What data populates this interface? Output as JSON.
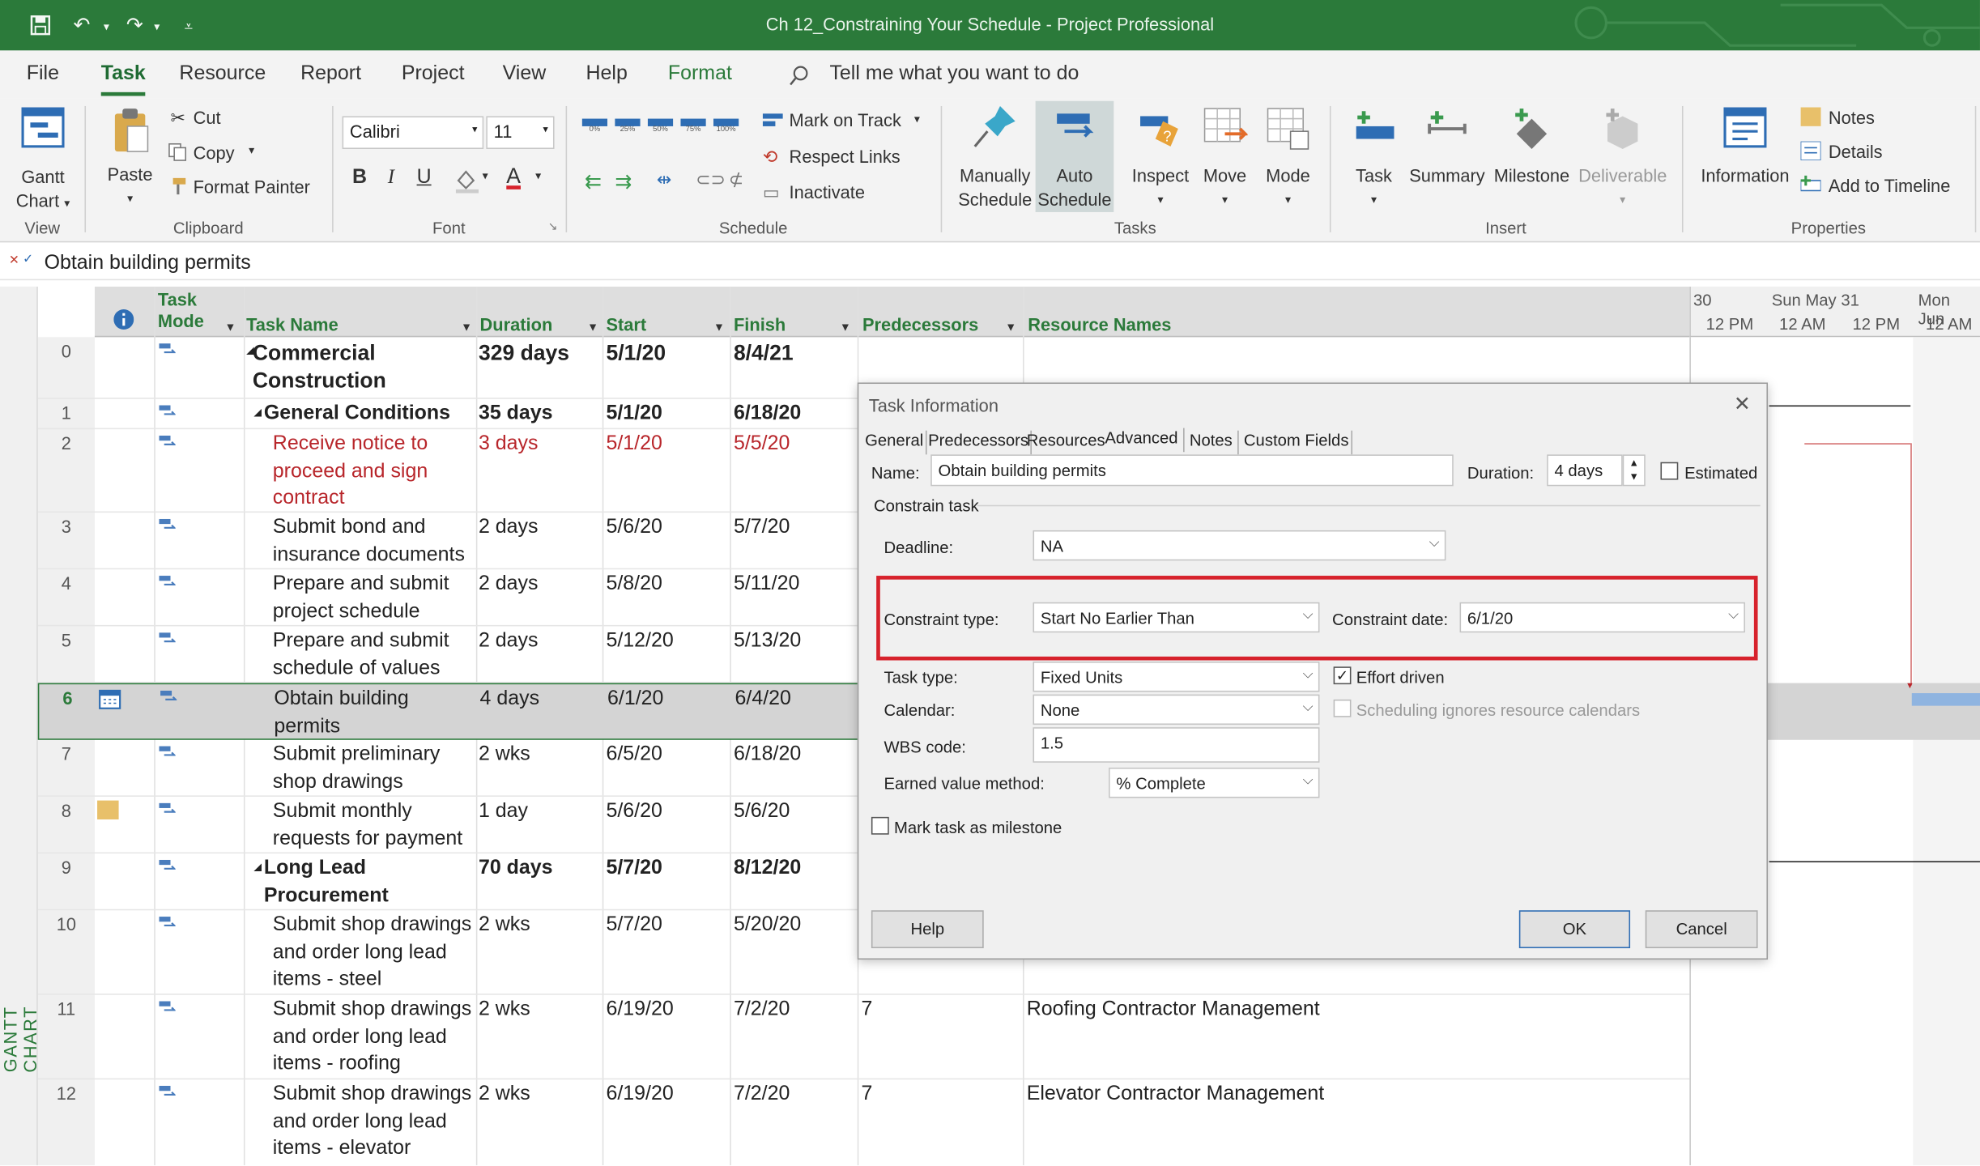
{
  "window": {
    "title": "Ch 12_Constraining Your Schedule  -  Project Professional"
  },
  "menu": {
    "tabs": [
      "File",
      "Task",
      "Resource",
      "Report",
      "Project",
      "View",
      "Help",
      "Format"
    ],
    "tell_me": "Tell me what you want to do"
  },
  "ribbon": {
    "view": {
      "gantt": "Gantt",
      "chart": "Chart",
      "label": "View"
    },
    "clipboard": {
      "paste": "Paste",
      "cut": "Cut",
      "copy": "Copy",
      "format_painter": "Format Painter",
      "label": "Clipboard"
    },
    "font": {
      "name": "Calibri",
      "size": "11",
      "bold": "B",
      "italic": "I",
      "underline": "U",
      "font_color": "A",
      "label": "Font"
    },
    "schedule": {
      "pcts": [
        "0%",
        "25%",
        "50%",
        "75%",
        "100%"
      ],
      "mark_on_track": "Mark on Track",
      "respect_links": "Respect Links",
      "inactivate": "Inactivate",
      "label": "Schedule"
    },
    "tasks": {
      "manually": "Manually",
      "schedule1": "Schedule",
      "auto": "Auto",
      "schedule2": "Schedule",
      "inspect": "Inspect",
      "move": "Move",
      "mode": "Mode",
      "label": "Tasks"
    },
    "insert": {
      "task": "Task",
      "summary": "Summary",
      "milestone": "Milestone",
      "deliverable": "Deliverable",
      "label": "Insert"
    },
    "properties": {
      "information": "Information",
      "notes": "Notes",
      "details": "Details",
      "add_to_timeline": "Add to Timeline",
      "label": "Properties"
    },
    "colors": {
      "accent": "#2b7a3a"
    }
  },
  "entry": {
    "value": "Obtain building permits"
  },
  "side_label": "GANTT CHART",
  "grid": {
    "headers": {
      "mode1": "Task",
      "mode2": "Mode",
      "name": "Task Name",
      "duration": "Duration",
      "start": "Start",
      "finish": "Finish",
      "pred": "Predecessors",
      "res": "Resource Names"
    },
    "rows": [
      {
        "id": "0",
        "name": [
          "Commercial",
          "Construction"
        ],
        "duration": "329 days",
        "start": "5/1/20",
        "finish": "8/4/21",
        "pred": "",
        "res": ""
      },
      {
        "id": "1",
        "name": [
          "General Conditions"
        ],
        "duration": "35 days",
        "start": "5/1/20",
        "finish": "6/18/20",
        "pred": "",
        "res": ""
      },
      {
        "id": "2",
        "name": [
          "Receive notice to",
          "proceed and sign",
          "contract"
        ],
        "duration": "3 days",
        "start": "5/1/20",
        "finish": "5/5/20",
        "pred": "",
        "res": ""
      },
      {
        "id": "3",
        "name": [
          "Submit bond and",
          "insurance documents"
        ],
        "duration": "2 days",
        "start": "5/6/20",
        "finish": "5/7/20",
        "pred": "",
        "res": ""
      },
      {
        "id": "4",
        "name": [
          "Prepare and submit",
          "project schedule"
        ],
        "duration": "2 days",
        "start": "5/8/20",
        "finish": "5/11/20",
        "pred": "",
        "res": ""
      },
      {
        "id": "5",
        "name": [
          "Prepare and submit",
          "schedule of values"
        ],
        "duration": "2 days",
        "start": "5/12/20",
        "finish": "5/13/20",
        "pred": "",
        "res": ""
      },
      {
        "id": "6",
        "name": [
          "Obtain building",
          "permits"
        ],
        "duration": "4 days",
        "start": "6/1/20",
        "finish": "6/4/20",
        "pred": "",
        "res": ""
      },
      {
        "id": "7",
        "name": [
          "Submit preliminary",
          "shop drawings"
        ],
        "duration": "2 wks",
        "start": "6/5/20",
        "finish": "6/18/20",
        "pred": "",
        "res": ""
      },
      {
        "id": "8",
        "name": [
          "Submit monthly",
          "requests for payment"
        ],
        "duration": "1 day",
        "start": "5/6/20",
        "finish": "5/6/20",
        "pred": "",
        "res": ""
      },
      {
        "id": "9",
        "name": [
          "Long Lead",
          "Procurement"
        ],
        "duration": "70 days",
        "start": "5/7/20",
        "finish": "8/12/20",
        "pred": "",
        "res": ""
      },
      {
        "id": "10",
        "name": [
          "Submit shop drawings",
          "and order long lead",
          "items - steel"
        ],
        "duration": "2 wks",
        "start": "5/7/20",
        "finish": "5/20/20",
        "pred": "",
        "res": ""
      },
      {
        "id": "11",
        "name": [
          "Submit shop drawings",
          "and order long lead",
          "items - roofing"
        ],
        "duration": "2 wks",
        "start": "6/19/20",
        "finish": "7/2/20",
        "pred": "7",
        "res": "Roofing Contractor Management"
      },
      {
        "id": "12",
        "name": [
          "Submit shop drawings",
          "and order long lead",
          "items - elevator"
        ],
        "duration": "2 wks",
        "start": "6/19/20",
        "finish": "7/2/20",
        "pred": "7",
        "res": "Elevator Contractor Management"
      }
    ]
  },
  "timescale": {
    "top": [
      "30",
      "Sun May 31",
      "Mon Jun"
    ],
    "bottom": [
      "12 PM",
      "12 AM",
      "12 PM",
      "12 AM"
    ]
  },
  "dialog": {
    "title": "Task Information",
    "tabs": [
      "General",
      "Predecessors",
      "Resources",
      "Advanced",
      "Notes",
      "Custom Fields"
    ],
    "name_label": "Name:",
    "name_value": "Obtain building permits",
    "duration_label": "Duration:",
    "duration_value": "4 days",
    "estimated": "Estimated",
    "constrain_task": "Constrain task",
    "deadline_label": "Deadline:",
    "deadline_value": "NA",
    "constraint_type_label": "Constraint type:",
    "constraint_type_value": "Start No Earlier Than",
    "constraint_date_label": "Constraint date:",
    "constraint_date_value": "6/1/20",
    "task_type_label": "Task type:",
    "task_type_value": "Fixed Units",
    "effort_driven": "Effort driven",
    "calendar_label": "Calendar:",
    "calendar_value": "None",
    "sched_ignores": "Scheduling ignores resource calendars",
    "wbs_label": "WBS code:",
    "wbs_value": "1.5",
    "evm_label": "Earned value method:",
    "evm_value": "% Complete",
    "milestone": "Mark task as milestone",
    "help": "Help",
    "ok": "OK",
    "cancel": "Cancel",
    "highlight_color": "#d7222c"
  }
}
